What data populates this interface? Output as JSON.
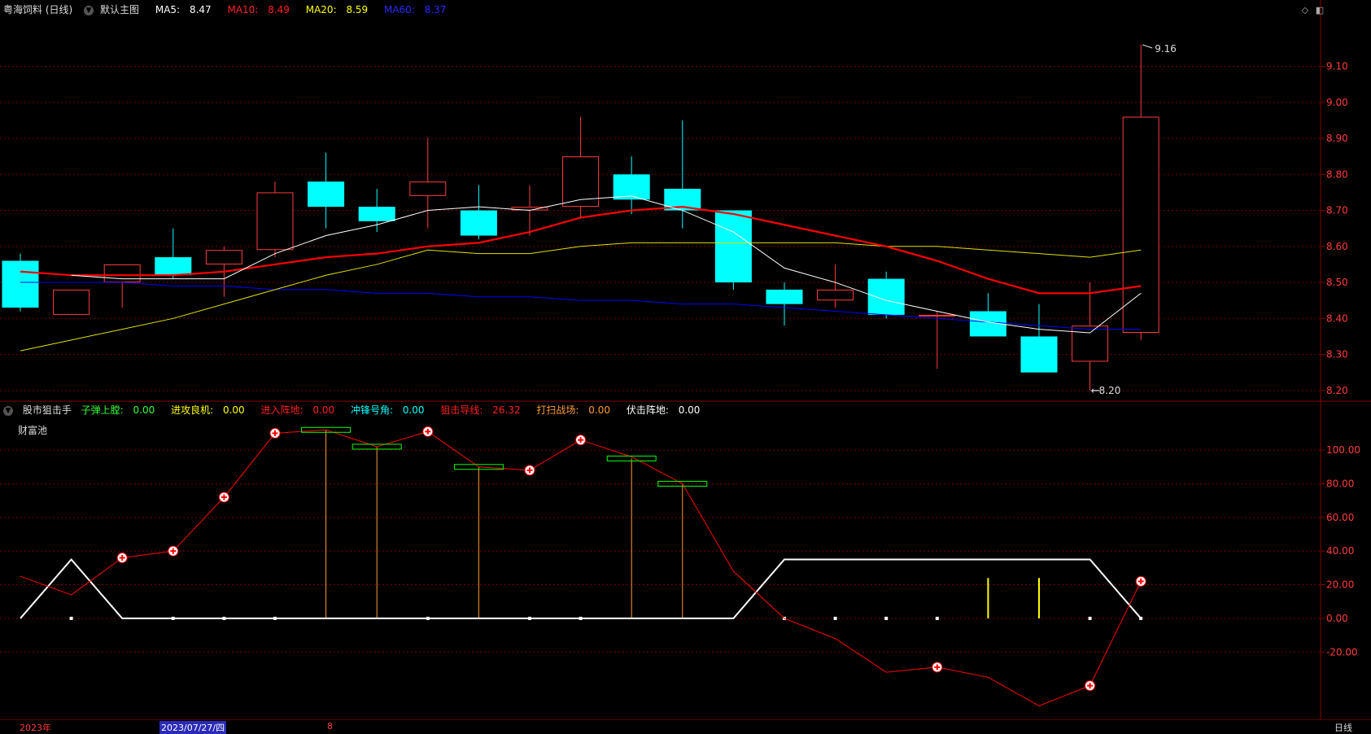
{
  "main_header": {
    "title": "粤海饲料 (日线)",
    "chart_name": "默认主图",
    "ma5": {
      "label": "MA5:",
      "value": "8.47"
    },
    "ma10": {
      "label": "MA10:",
      "value": "8.49"
    },
    "ma20": {
      "label": "MA20:",
      "value": "8.59"
    },
    "ma60": {
      "label": "MA60:",
      "value": "8.37"
    }
  },
  "sub_header": {
    "title": "股市狙击手",
    "items": [
      {
        "label": "子弹上膛:",
        "value": "0.00"
      },
      {
        "label": "进攻良机:",
        "value": "0.00"
      },
      {
        "label": "进入阵地:",
        "value": "0.00"
      },
      {
        "label": "冲锋号角:",
        "value": "0.00"
      },
      {
        "label": "狙击导线:",
        "value": "26.32"
      },
      {
        "label": "打扫战场:",
        "value": "0.00"
      },
      {
        "label": "伏击阵地:",
        "value": "0.00"
      }
    ],
    "sub_label": "财富池"
  },
  "colors": {
    "up": "#ff3c3c",
    "down": "#00ffff",
    "ma5": "#ffffff",
    "ma10": "#ff0000",
    "ma20": "#e0e000",
    "ma60": "#0000ff",
    "grid": "#7a0000",
    "axis_text": "#ff3c3c",
    "sniper_line": "#ff0000",
    "white_line": "#ffffff",
    "green_box": "#00ff00",
    "stem": "#ff9933",
    "yellow_stem": "#ffff00"
  },
  "chart_data": [
    {
      "type": "candlestick",
      "y_ticks": [
        "9.10",
        "9.00",
        "8.90",
        "8.80",
        "8.70",
        "8.60",
        "8.50",
        "8.40",
        "8.30",
        "8.20"
      ],
      "ylim": [
        8.177,
        9.23
      ],
      "max_label": "9.16",
      "min_label": "8.20",
      "candles": [
        {
          "o": 8.56,
          "h": 8.58,
          "l": 8.42,
          "c": 8.43
        },
        {
          "o": 8.41,
          "h": 8.48,
          "l": 8.41,
          "c": 8.48
        },
        {
          "o": 8.5,
          "h": 8.55,
          "l": 8.43,
          "c": 8.55
        },
        {
          "o": 8.57,
          "h": 8.65,
          "l": 8.51,
          "c": 8.52
        },
        {
          "o": 8.55,
          "h": 8.6,
          "l": 8.46,
          "c": 8.59
        },
        {
          "o": 8.59,
          "h": 8.78,
          "l": 8.57,
          "c": 8.75
        },
        {
          "o": 8.78,
          "h": 8.86,
          "l": 8.65,
          "c": 8.71
        },
        {
          "o": 8.71,
          "h": 8.76,
          "l": 8.64,
          "c": 8.67
        },
        {
          "o": 8.74,
          "h": 8.9,
          "l": 8.65,
          "c": 8.78
        },
        {
          "o": 8.7,
          "h": 8.77,
          "l": 8.62,
          "c": 8.63
        },
        {
          "o": 8.7,
          "h": 8.77,
          "l": 8.63,
          "c": 8.71
        },
        {
          "o": 8.71,
          "h": 8.96,
          "l": 8.68,
          "c": 8.85
        },
        {
          "o": 8.8,
          "h": 8.85,
          "l": 8.69,
          "c": 8.73
        },
        {
          "o": 8.76,
          "h": 8.95,
          "l": 8.65,
          "c": 8.7
        },
        {
          "o": 8.7,
          "h": 8.7,
          "l": 8.48,
          "c": 8.5
        },
        {
          "o": 8.48,
          "h": 8.5,
          "l": 8.38,
          "c": 8.44
        },
        {
          "o": 8.45,
          "h": 8.55,
          "l": 8.43,
          "c": 8.48
        },
        {
          "o": 8.51,
          "h": 8.53,
          "l": 8.4,
          "c": 8.41
        },
        {
          "o": 8.41,
          "h": 8.42,
          "l": 8.26,
          "c": 8.41
        },
        {
          "o": 8.42,
          "h": 8.47,
          "l": 8.35,
          "c": 8.35
        },
        {
          "o": 8.35,
          "h": 8.44,
          "l": 8.25,
          "c": 8.25
        },
        {
          "o": 8.28,
          "h": 8.5,
          "l": 8.2,
          "c": 8.38
        },
        {
          "o": 8.36,
          "h": 9.16,
          "l": 8.34,
          "c": 8.96
        }
      ],
      "ma5": [
        null,
        8.52,
        8.51,
        8.51,
        8.51,
        8.58,
        8.63,
        8.66,
        8.7,
        8.71,
        8.7,
        8.73,
        8.74,
        8.7,
        8.64,
        8.54,
        8.5,
        8.45,
        8.42,
        8.39,
        8.37,
        8.36,
        8.47
      ],
      "ma10": [
        8.53,
        8.52,
        8.52,
        8.52,
        8.53,
        8.55,
        8.57,
        8.58,
        8.6,
        8.61,
        8.64,
        8.68,
        8.7,
        8.71,
        8.69,
        8.66,
        8.63,
        8.6,
        8.56,
        8.51,
        8.47,
        8.47,
        8.49
      ],
      "ma20": [
        8.31,
        8.34,
        8.37,
        8.4,
        8.44,
        8.48,
        8.52,
        8.55,
        8.59,
        8.58,
        8.58,
        8.6,
        8.61,
        8.61,
        8.61,
        8.61,
        8.61,
        8.6,
        8.6,
        8.59,
        8.58,
        8.57,
        8.59
      ],
      "ma60": [
        8.5,
        8.5,
        8.5,
        8.49,
        8.49,
        8.48,
        8.48,
        8.47,
        8.47,
        8.46,
        8.46,
        8.45,
        8.45,
        8.44,
        8.44,
        8.43,
        8.42,
        8.41,
        8.4,
        8.39,
        8.38,
        8.37,
        8.37
      ]
    },
    {
      "type": "line",
      "y_ticks": [
        "100.00",
        "80.00",
        "60.00",
        "40.00",
        "20.00",
        "0.00",
        "-20.00"
      ],
      "ylim": [
        -60,
        116
      ],
      "sniper_line": [
        25,
        14,
        36,
        40,
        72,
        110,
        112,
        102,
        111,
        90,
        88,
        106,
        96,
        80,
        28,
        0,
        -12,
        -32,
        -29,
        -35,
        -52,
        -40,
        22
      ],
      "plus_markers": [
        2,
        3,
        4,
        5,
        8,
        10,
        11,
        18,
        21,
        22
      ],
      "white_line": [
        0,
        35,
        0,
        0,
        0,
        0,
        0,
        0,
        0,
        0,
        0,
        0,
        0,
        0,
        0,
        35,
        35,
        35,
        35,
        35,
        35,
        35,
        0
      ],
      "green_boxes": [
        {
          "index": 6,
          "value": 112
        },
        {
          "index": 7,
          "value": 102
        },
        {
          "index": 9,
          "value": 90
        },
        {
          "index": 12,
          "value": 95
        },
        {
          "index": 13,
          "value": 80
        }
      ],
      "yellow_stems": [
        {
          "index": 19,
          "value": 24
        },
        {
          "index": 20,
          "value": 24
        }
      ],
      "dots": [
        1,
        3,
        4,
        5,
        8,
        10,
        11,
        15,
        16,
        17,
        18,
        21,
        22
      ]
    }
  ],
  "bottom_bar": {
    "year": "2023年",
    "date": "2023/07/27/四",
    "marker": "8",
    "period": "日线"
  }
}
